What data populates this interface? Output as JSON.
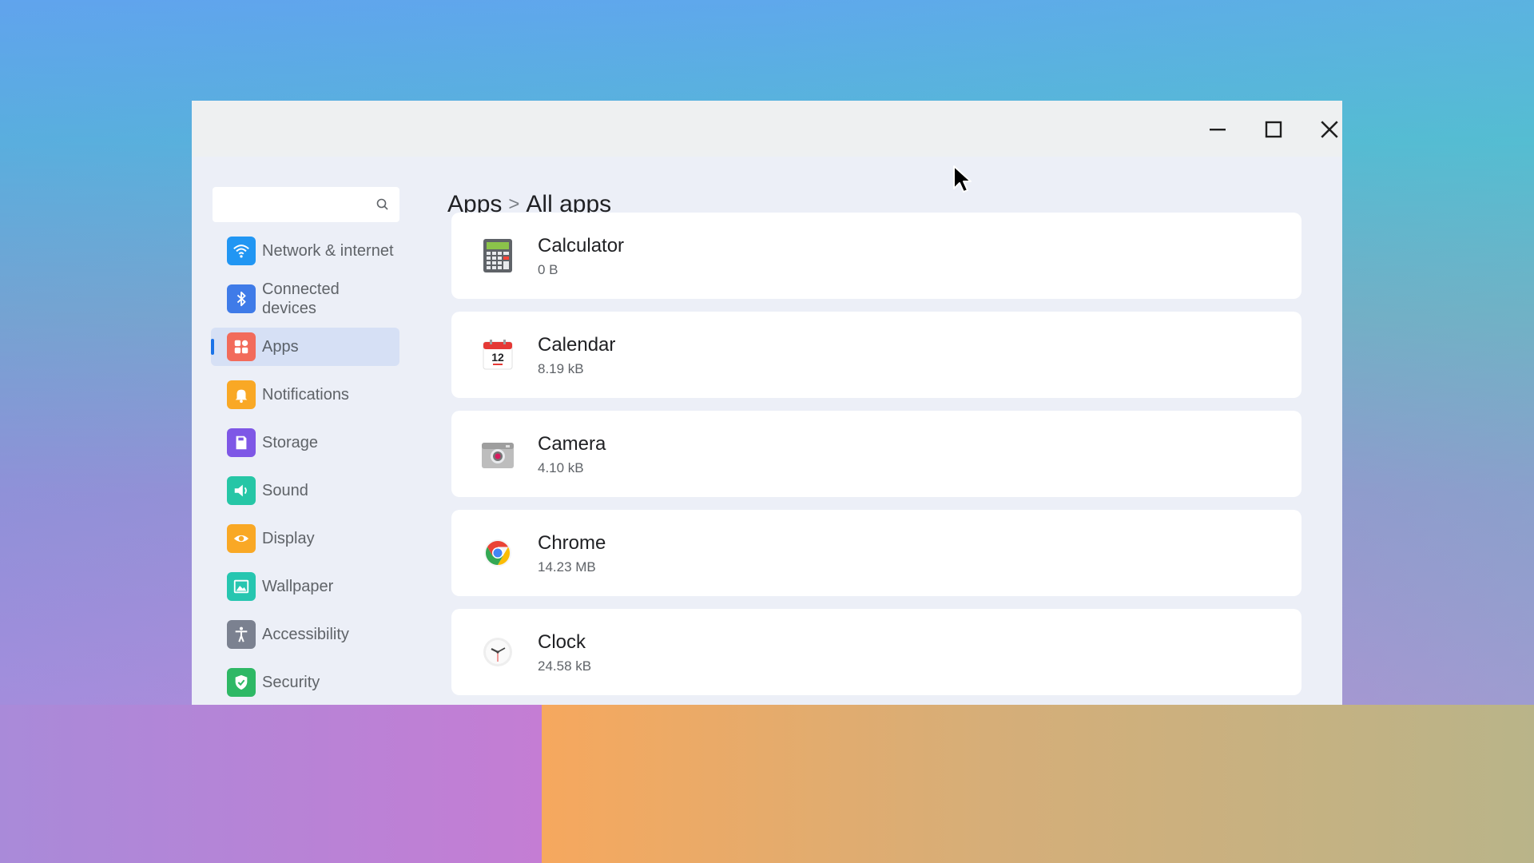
{
  "window": {
    "controls": {
      "minimize": "minimize-icon",
      "maximize": "maximize-icon",
      "close": "close-icon"
    }
  },
  "sidebar": {
    "search": {
      "value": "",
      "placeholder": "",
      "icon": "search-icon"
    },
    "items": [
      {
        "label": "Network & internet",
        "icon": "wifi-icon",
        "color": "#2196f3"
      },
      {
        "label": "Connected devices",
        "icon": "bluetooth-icon",
        "color": "#3f7be8"
      },
      {
        "label": "Apps",
        "icon": "apps-icon",
        "color": "#f26b5b",
        "active": true
      },
      {
        "label": "Notifications",
        "icon": "bell-icon",
        "color": "#f9a825"
      },
      {
        "label": "Storage",
        "icon": "storage-icon",
        "color": "#7e57e6"
      },
      {
        "label": "Sound",
        "icon": "speaker-icon",
        "color": "#26c6a6"
      },
      {
        "label": "Display",
        "icon": "eye-icon",
        "color": "#f9a825"
      },
      {
        "label": "Wallpaper",
        "icon": "image-icon",
        "color": "#26c6b0"
      },
      {
        "label": "Accessibility",
        "icon": "accessibility-icon",
        "color": "#7b8190"
      },
      {
        "label": "Security",
        "icon": "shield-check-icon",
        "color": "#2eb865"
      }
    ]
  },
  "main": {
    "breadcrumb": {
      "parent": "Apps",
      "separator": ">",
      "current": "All apps"
    },
    "apps": [
      {
        "name": "Calculator",
        "size": "0 B",
        "icon": "calculator-icon"
      },
      {
        "name": "Calendar",
        "size": "8.19 kB",
        "icon": "calendar-icon",
        "icon_text": "12"
      },
      {
        "name": "Camera",
        "size": "4.10 kB",
        "icon": "camera-icon"
      },
      {
        "name": "Chrome",
        "size": "14.23 MB",
        "icon": "chrome-icon"
      },
      {
        "name": "Clock",
        "size": "24.58 kB",
        "icon": "clock-icon"
      }
    ]
  },
  "colors": {
    "accent": "#1a73e8",
    "active_item_bg": "#d6e0f5",
    "window_bg": "#eceff7",
    "titlebar_bg": "#eef0f1"
  }
}
